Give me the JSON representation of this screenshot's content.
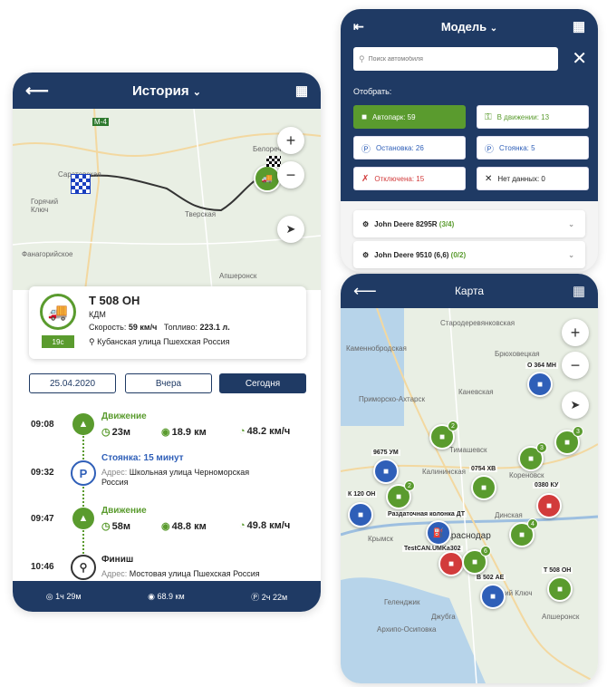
{
  "history": {
    "title": "История",
    "map_labels": [
      "М-4",
      "Саратовская",
      "Горячий Ключ",
      "Тверская",
      "Белореченск",
      "Фанагорийское",
      "Апшеронск",
      "А-146"
    ],
    "vehicle": {
      "plate": "Т 508 ОН",
      "model": "КДМ",
      "speed_label": "Скорость:",
      "speed_value": "59 км/ч",
      "fuel_label": "Топливо:",
      "fuel_value": "223.1 л.",
      "address": "Кубанская улица Пшехская Россия",
      "badge": "19с"
    },
    "dates": [
      "25.04.2020",
      "Вчера",
      "Сегодня"
    ],
    "events": [
      {
        "time": "09:08",
        "title": "Движение",
        "dur": "23м",
        "dist": "18.9 км",
        "speed": "48.2 км/ч"
      },
      {
        "time": "09:32",
        "title": "Стоянка: 15 минут",
        "addr_key": "Адрес:",
        "addr": "Школьная улица Черноморская",
        "addr2": "Россия"
      },
      {
        "time": "09:47",
        "title": "Движение",
        "dur": "58м",
        "dist": "48.8 км",
        "speed": "49.8 км/ч"
      },
      {
        "time": "10:46",
        "title": "Финиш",
        "addr_key": "Адрес:",
        "addr": "Мостовая улица Пшехская Россия"
      }
    ],
    "footer": {
      "drive": "1ч 29м",
      "dist": "68.9 км",
      "park": "2ч 22м"
    }
  },
  "model": {
    "title": "Модель",
    "search_placeholder": "Поиск автомобиля",
    "filter_label": "Отобрать:",
    "filters": [
      {
        "label": "Автопарк: 59"
      },
      {
        "label": "В движении: 13"
      },
      {
        "label": "Остановка: 26"
      },
      {
        "label": "Стоянка: 5"
      },
      {
        "label": "Отключена: 15"
      },
      {
        "label": "Нет данных: 0"
      }
    ],
    "rows": [
      {
        "name": "John Deere 8295R",
        "count": "(3/4)"
      },
      {
        "name": "John Deere 9510 (6,6)",
        "count": "(0/2)"
      }
    ]
  },
  "karta": {
    "title": "Карта",
    "map_labels": [
      "Каменнобродская",
      "Стародеревянковская",
      "Брюховецкая",
      "Приморско-Ахтарск",
      "Каневская",
      "Тимашевск",
      "Кореновск",
      "Калининская",
      "Динская",
      "Крымск",
      "Краснодар",
      "Геленджик",
      "Джубга",
      "Архипо-Осиповка",
      "Горячий Ключ",
      "Апшеронск"
    ],
    "markers": [
      "О 364 МН",
      "9675 УМ",
      "0754 ХВ",
      "К 120 ОН",
      "0380 КУ",
      "Раздаточная колонка ДТ",
      "TestCAN.UMKa302",
      "В 502 АЕ",
      "Т 508 ОН"
    ],
    "badges": [
      "2",
      "2",
      "3",
      "3",
      "4",
      "2",
      "6"
    ]
  },
  "colors": {
    "navy": "#1f3a64",
    "green": "#5a9b2e",
    "blue": "#2f5fb8",
    "red": "#d23b3b"
  }
}
